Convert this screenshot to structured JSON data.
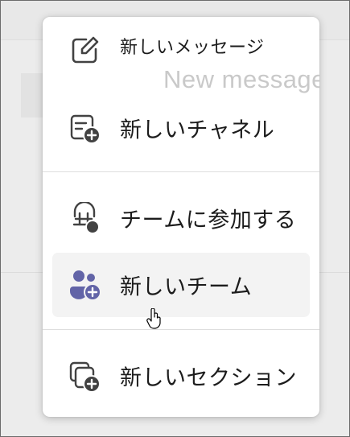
{
  "menu": {
    "new_message": {
      "label": "新しいメッセージ",
      "ghost_text": "New message",
      "icon": "compose-icon"
    },
    "new_channel": {
      "label": "新しいチャネル",
      "icon": "add-channel-icon"
    },
    "join_team": {
      "label": "チームに参加する",
      "icon": "join-team-icon"
    },
    "new_team": {
      "label": "新しいチーム",
      "icon": "people-add-icon",
      "accent": "#6264a7"
    },
    "new_section": {
      "label": "新しいセクション",
      "icon": "add-section-icon"
    }
  },
  "colors": {
    "icon_dark": "#424242",
    "accent": "#6264a7",
    "hover_bg": "#f3f3f3"
  }
}
